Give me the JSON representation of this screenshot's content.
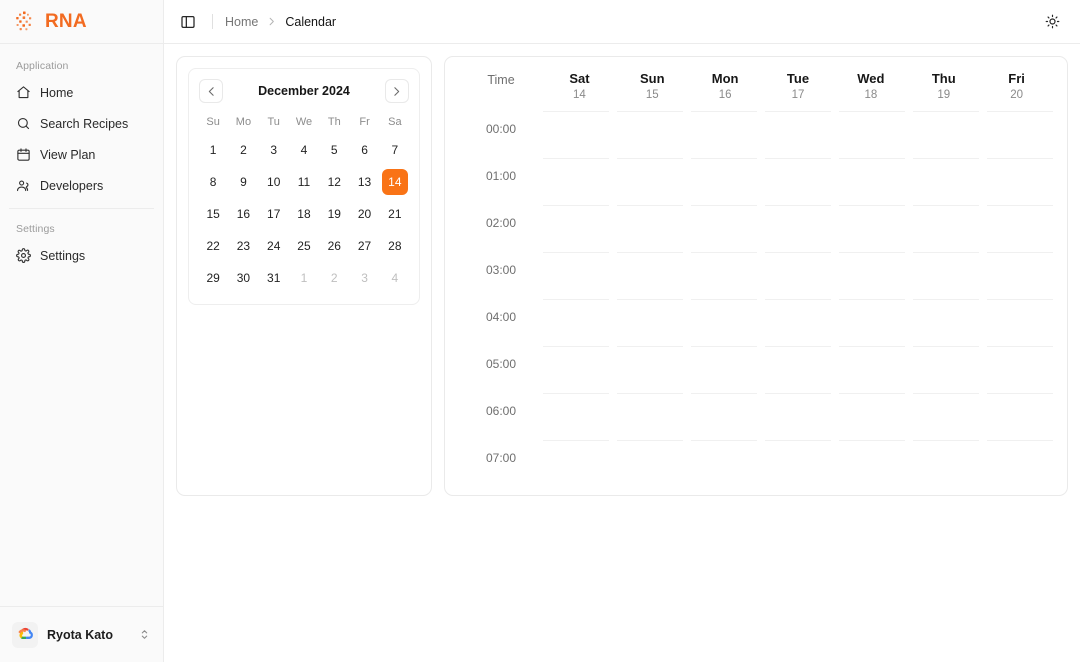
{
  "brand": {
    "name": "RNA",
    "logo_icon": "dots-logo-icon",
    "accent": "#f26b21"
  },
  "sidebar": {
    "groups": [
      {
        "label": "Application",
        "items": [
          {
            "label": "Home",
            "icon": "home-icon"
          },
          {
            "label": "Search Recipes",
            "icon": "search-icon"
          },
          {
            "label": "View Plan",
            "icon": "calendar-icon"
          },
          {
            "label": "Developers",
            "icon": "users-icon"
          }
        ]
      },
      {
        "label": "Settings",
        "items": [
          {
            "label": "Settings",
            "icon": "gear-icon"
          }
        ]
      }
    ],
    "user": {
      "name": "Ryota Kato",
      "avatar_icon": "google-cloud-avatar",
      "chevron_icon": "chevrons-up-down-icon"
    }
  },
  "topbar": {
    "sidebar_toggle_icon": "panel-left-icon",
    "breadcrumb": {
      "home": "Home",
      "separator": "›",
      "current": "Calendar"
    },
    "theme_toggle_icon": "sun-icon"
  },
  "calendar": {
    "prev_icon": "chevron-left-icon",
    "next_icon": "chevron-right-icon",
    "title": "December 2024",
    "weekdays": [
      "Su",
      "Mo",
      "Tu",
      "We",
      "Th",
      "Fr",
      "Sa"
    ],
    "selected_day": 14,
    "accent": "#f97316",
    "weeks": [
      [
        {
          "d": "1",
          "muted": false
        },
        {
          "d": "2",
          "muted": false
        },
        {
          "d": "3",
          "muted": false
        },
        {
          "d": "4",
          "muted": false
        },
        {
          "d": "5",
          "muted": false
        },
        {
          "d": "6",
          "muted": false
        },
        {
          "d": "7",
          "muted": false
        }
      ],
      [
        {
          "d": "8",
          "muted": false
        },
        {
          "d": "9",
          "muted": false
        },
        {
          "d": "10",
          "muted": false
        },
        {
          "d": "11",
          "muted": false
        },
        {
          "d": "12",
          "muted": false
        },
        {
          "d": "13",
          "muted": false
        },
        {
          "d": "14",
          "muted": false,
          "selected": true
        }
      ],
      [
        {
          "d": "15",
          "muted": false
        },
        {
          "d": "16",
          "muted": false
        },
        {
          "d": "17",
          "muted": false
        },
        {
          "d": "18",
          "muted": false
        },
        {
          "d": "19",
          "muted": false
        },
        {
          "d": "20",
          "muted": false
        },
        {
          "d": "21",
          "muted": false
        }
      ],
      [
        {
          "d": "22",
          "muted": false
        },
        {
          "d": "23",
          "muted": false
        },
        {
          "d": "24",
          "muted": false
        },
        {
          "d": "25",
          "muted": false
        },
        {
          "d": "26",
          "muted": false
        },
        {
          "d": "27",
          "muted": false
        },
        {
          "d": "28",
          "muted": false
        }
      ],
      [
        {
          "d": "29",
          "muted": false
        },
        {
          "d": "30",
          "muted": false
        },
        {
          "d": "31",
          "muted": false
        },
        {
          "d": "1",
          "muted": true
        },
        {
          "d": "2",
          "muted": true
        },
        {
          "d": "3",
          "muted": true
        },
        {
          "d": "4",
          "muted": true
        }
      ]
    ]
  },
  "schedule": {
    "time_header": "Time",
    "days": [
      {
        "dow": "Sat",
        "num": "14"
      },
      {
        "dow": "Sun",
        "num": "15"
      },
      {
        "dow": "Mon",
        "num": "16"
      },
      {
        "dow": "Tue",
        "num": "17"
      },
      {
        "dow": "Wed",
        "num": "18"
      },
      {
        "dow": "Thu",
        "num": "19"
      },
      {
        "dow": "Fri",
        "num": "20"
      }
    ],
    "times": [
      "00:00",
      "01:00",
      "02:00",
      "03:00",
      "04:00",
      "05:00",
      "06:00",
      "07:00"
    ],
    "events": []
  }
}
